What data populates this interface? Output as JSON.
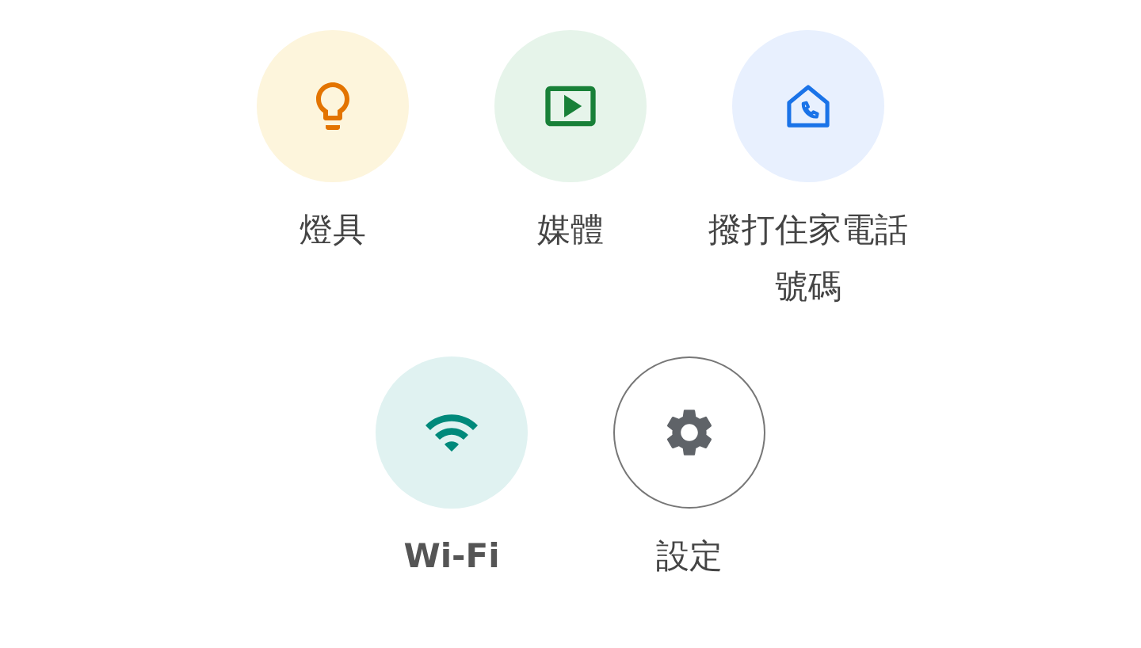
{
  "shortcut_rows": [
    {
      "items": [
        {
          "kind": "lights",
          "label": "燈具"
        },
        {
          "kind": "media",
          "label": "媒體"
        },
        {
          "kind": "call_home",
          "label": "撥打住家電話號碼"
        }
      ]
    },
    {
      "items": [
        {
          "kind": "wifi",
          "label": "Wi-Fi"
        },
        {
          "kind": "settings",
          "label": "設定"
        }
      ]
    }
  ]
}
